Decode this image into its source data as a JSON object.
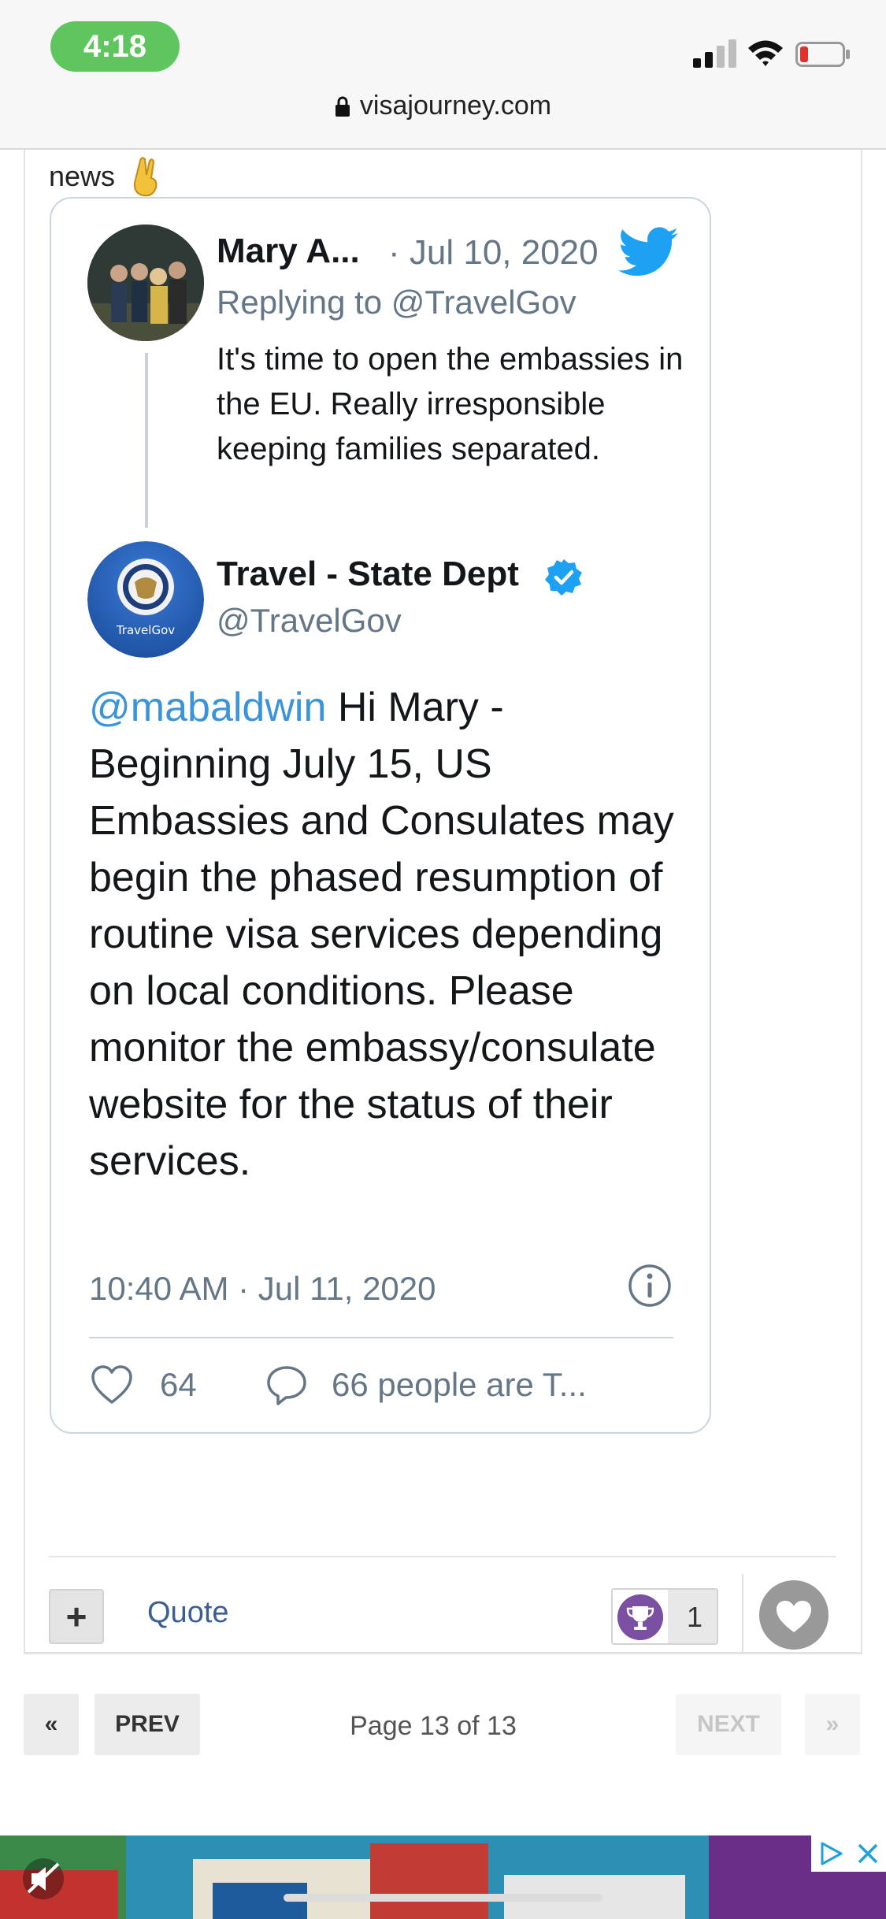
{
  "status_bar": {
    "time": "4:18"
  },
  "browser": {
    "url": "visajourney.com"
  },
  "post": {
    "intro_text": "news",
    "tweet": {
      "reply_author": "Mary A...",
      "reply_date": "· Jul 10, 2020",
      "replying_to": "Replying to @TravelGov",
      "reply_text": "It's time to open the embassies in the EU. Really irresponsible keeping families separated.",
      "author_name": "Travel - State Dept",
      "author_handle": "@TravelGov",
      "avatar_label": "TravelGov",
      "mention": "@mabaldwin",
      "body": " Hi Mary - Beginning July 15, US Embassies and Consulates may begin the phased resumption of routine visa services depending on local conditions. Please monitor the embassy/consulate website for the status of their services.",
      "timestamp": "10:40 AM · Jul 11, 2020",
      "likes": "64",
      "talking": "66 people are T..."
    },
    "footer": {
      "plus_label": "+",
      "quote_label": "Quote",
      "reputation_count": "1"
    }
  },
  "pagination": {
    "first_label": "«",
    "prev_label": "PREV",
    "page_label": "Page 13 of 13",
    "next_label": "NEXT",
    "last_label": "»"
  },
  "colors": {
    "accent": "#3b94d9",
    "time_pill": "#5fc65f",
    "trophy": "#7b4fa2"
  }
}
